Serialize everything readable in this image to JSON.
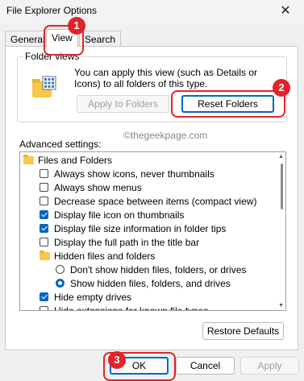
{
  "window": {
    "title": "File Explorer Options"
  },
  "tabs": [
    {
      "label": "General"
    },
    {
      "label": "View"
    },
    {
      "label": "Search"
    }
  ],
  "folder_views": {
    "group_label": "Folder views",
    "description": "You can apply this view (such as Details or Icons) to all folders of this type.",
    "apply_label": "Apply to Folders",
    "reset_label": "Reset Folders"
  },
  "watermark": "©thegeekpage.com",
  "advanced": {
    "label": "Advanced settings:",
    "items": [
      {
        "kind": "folder",
        "label": "Files and Folders"
      },
      {
        "kind": "checkbox",
        "label": "Always show icons, never thumbnails",
        "checked": false
      },
      {
        "kind": "checkbox",
        "label": "Always show menus",
        "checked": false
      },
      {
        "kind": "checkbox",
        "label": "Decrease space between items (compact view)",
        "checked": false
      },
      {
        "kind": "checkbox",
        "label": "Display file icon on thumbnails",
        "checked": true
      },
      {
        "kind": "checkbox",
        "label": "Display file size information in folder tips",
        "checked": true
      },
      {
        "kind": "checkbox",
        "label": "Display the full path in the title bar",
        "checked": false
      },
      {
        "kind": "folder",
        "label": "Hidden files and folders"
      },
      {
        "kind": "radio",
        "label": "Don't show hidden files, folders, or drives",
        "checked": false
      },
      {
        "kind": "radio",
        "label": "Show hidden files, folders, and drives",
        "checked": true
      },
      {
        "kind": "checkbox",
        "label": "Hide empty drives",
        "checked": true
      },
      {
        "kind": "checkbox",
        "label": "Hide extensions for known file types",
        "checked": false
      }
    ]
  },
  "restore_label": "Restore Defaults",
  "buttons": {
    "ok": "OK",
    "cancel": "Cancel",
    "apply": "Apply"
  },
  "callouts": [
    "1",
    "2",
    "3"
  ],
  "colors": {
    "accent": "#0067c0",
    "callout": "#e3232a"
  }
}
